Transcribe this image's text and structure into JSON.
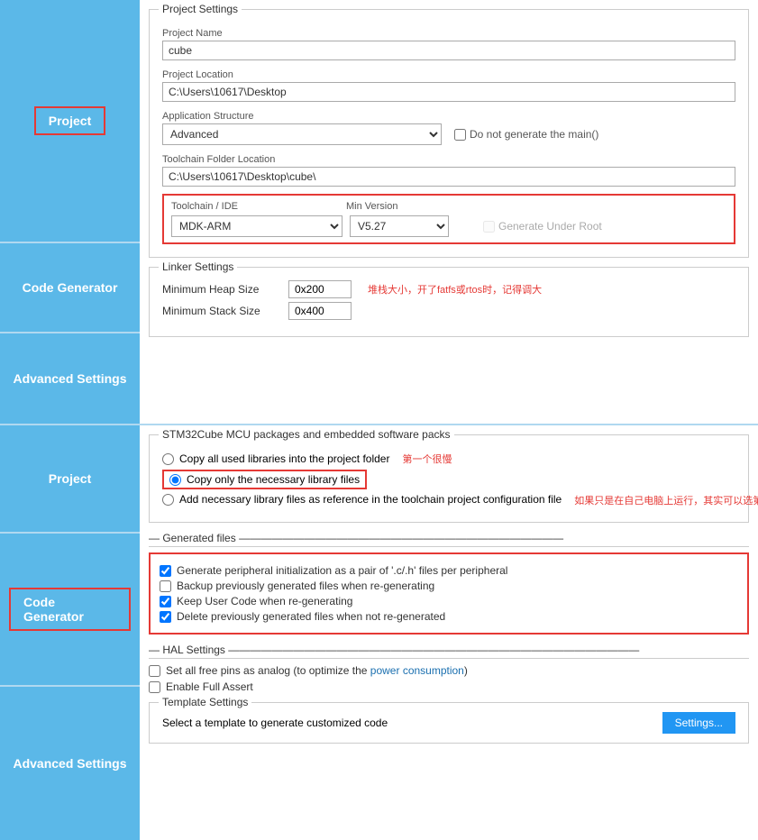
{
  "sidebar": {
    "panel1": {
      "project_label": "Project",
      "code_generator_label": "Code Generator",
      "advanced_settings_label": "Advanced Settings"
    },
    "panel2": {
      "project_label": "Project",
      "code_generator_label": "Code Generator",
      "advanced_settings_label": "Advanced Settings"
    }
  },
  "project_settings": {
    "section_title": "Project Settings",
    "project_name_label": "Project Name",
    "project_name_value": "cube",
    "project_location_label": "Project Location",
    "project_location_value": "C:\\Users\\10617\\Desktop",
    "application_structure_label": "Application Structure",
    "application_structure_value": "Advanced",
    "do_not_generate_main_label": "Do not generate the main()",
    "toolchain_folder_label": "Toolchain Folder Location",
    "toolchain_folder_value": "C:\\Users\\10617\\Desktop\\cube\\",
    "toolchain_ide_label": "Toolchain / IDE",
    "min_version_label": "Min Version",
    "toolchain_value": "MDK-ARM",
    "min_version_value": "V5.27",
    "generate_under_root_label": "Generate Under Root"
  },
  "linker_settings": {
    "section_title": "Linker Settings",
    "min_heap_label": "Minimum Heap Size",
    "min_heap_value": "0x200",
    "min_stack_label": "Minimum Stack Size",
    "min_stack_value": "0x400",
    "annotation": "堆栈大小，开了fatfs或rtos时，记得调大"
  },
  "stm32_packages": {
    "section_title": "STM32Cube MCU packages and embedded software packs",
    "option1_label": "Copy all used libraries into the project folder",
    "option1_annotation": "第一个很慢",
    "option2_label": "Copy only the necessary library files",
    "option3_label": "Add necessary library files as reference in the toolchain project configuration file",
    "option3_annotation": "如果只是在自己电脑上运行，其实可以选第三个，编译速度快"
  },
  "generated_files": {
    "section_title": "Generated files",
    "option1_label": "Generate peripheral initialization as a pair of '.c/.h' files per peripheral",
    "option1_checked": true,
    "option2_label": "Backup previously generated files when re-generating",
    "option2_checked": false,
    "option3_label": "Keep User Code when re-generating",
    "option3_checked": true,
    "option4_label": "Delete previously generated files when not re-generated",
    "option4_checked": true
  },
  "hal_settings": {
    "section_title": "HAL Settings",
    "option1_label": "Set all free pins as analog (to optimize the power consumption)",
    "option1_checked": false,
    "option2_label": "Enable Full Assert",
    "option2_checked": false
  },
  "template_settings": {
    "section_title": "Template Settings",
    "description": "Select a template to generate customized code",
    "settings_button_label": "Settings..."
  },
  "colors": {
    "sidebar_bg": "#5bb8e8",
    "accent_blue": "#2196f3",
    "red_border": "#e53935",
    "annotation_red": "#e53935"
  }
}
